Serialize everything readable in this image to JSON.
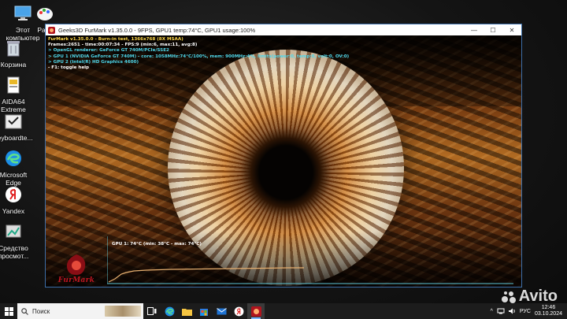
{
  "desktop": {
    "icons": [
      {
        "label": "Этот\nкомпьютер",
        "icon": "computer-icon"
      },
      {
        "label": "Paint",
        "icon": "paint-icon"
      },
      {
        "label": "Корзина",
        "icon": "recycle-bin-icon"
      },
      {
        "label": "AIDA64\nExtreme",
        "icon": "aida64-icon"
      },
      {
        "label": "keyboardte...",
        "icon": "keyboard-test-icon"
      },
      {
        "label": "Microsoft\nEdge",
        "icon": "edge-icon"
      },
      {
        "label": "Yandex",
        "icon": "yandex-icon"
      },
      {
        "label": "Средство\nпросмот...",
        "icon": "viewer-icon"
      }
    ]
  },
  "window": {
    "title": "Geeks3D FurMark v1.35.0.0 - 9FPS, GPU1 temp:74°C, GPU1 usage:100%",
    "controls": {
      "minimize": "—",
      "maximize": "☐",
      "close": "✕"
    }
  },
  "overlay": {
    "line1": "FurMark v1.35.0.0 - Burn-in test, 1366x768 (8X MSAA)",
    "line2": "Frames:2651 - time:00:07:34 - FPS:9 (min:6, max:11, avg:8)",
    "line3": "> OpenGL renderer: GeForce GT 740M/PCIe/SSE2",
    "line4": "> GPU 1 (NVIDIA GeForce GT 740M) - core: 1058MHz:74°C/100%, mem: 900MHz:4%, limits(power:0, temp:0, volt:0, OV:0)",
    "line5": "> GPU 2 (Intel(R) HD Graphics 4600)",
    "line6": "- F1: toggle help"
  },
  "graph": {
    "label": "GPU 1: 74°C (min: 38°C - max: 74°C)",
    "line_color": "#e8b070",
    "frame_color": "#5ec6d6"
  },
  "logo": {
    "text": "FurMark"
  },
  "watermark": {
    "text": "Avito"
  },
  "taskbar": {
    "search_placeholder": "Поиск",
    "apps": [
      "task-view-icon",
      "edge-icon",
      "explorer-icon",
      "store-icon",
      "mail-icon",
      "yandex-icon",
      "furmark-icon"
    ],
    "tray": {
      "lang": "РУС",
      "time": "12:46",
      "date": "03.10.2024"
    }
  },
  "colors": {
    "accent": "#3c6ea8",
    "furmark_red": "#c01622"
  }
}
